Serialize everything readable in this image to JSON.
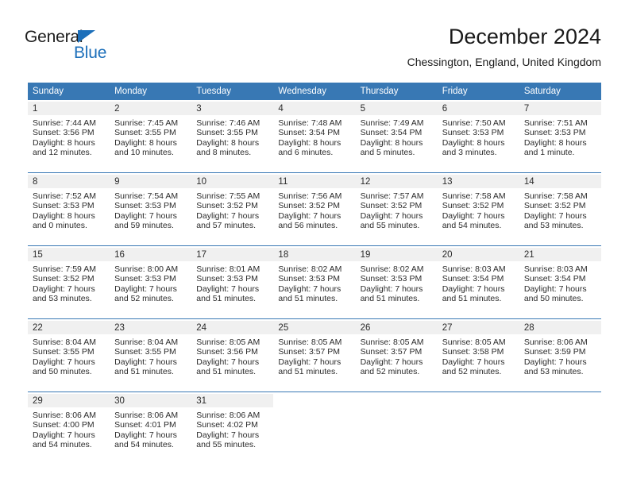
{
  "brand": {
    "name_top": "General",
    "name_bottom": "Blue",
    "accent_color": "#1c6fba"
  },
  "header": {
    "month_title": "December 2024",
    "location": "Chessington, England, United Kingdom"
  },
  "calendar": {
    "header_bg": "#3878b4",
    "daynum_bg": "#f0f0f0",
    "weekday_headers": [
      "Sunday",
      "Monday",
      "Tuesday",
      "Wednesday",
      "Thursday",
      "Friday",
      "Saturday"
    ],
    "weeks": [
      [
        {
          "day": "1",
          "sunrise": "Sunrise: 7:44 AM",
          "sunset": "Sunset: 3:56 PM",
          "daylight1": "Daylight: 8 hours",
          "daylight2": "and 12 minutes."
        },
        {
          "day": "2",
          "sunrise": "Sunrise: 7:45 AM",
          "sunset": "Sunset: 3:55 PM",
          "daylight1": "Daylight: 8 hours",
          "daylight2": "and 10 minutes."
        },
        {
          "day": "3",
          "sunrise": "Sunrise: 7:46 AM",
          "sunset": "Sunset: 3:55 PM",
          "daylight1": "Daylight: 8 hours",
          "daylight2": "and 8 minutes."
        },
        {
          "day": "4",
          "sunrise": "Sunrise: 7:48 AM",
          "sunset": "Sunset: 3:54 PM",
          "daylight1": "Daylight: 8 hours",
          "daylight2": "and 6 minutes."
        },
        {
          "day": "5",
          "sunrise": "Sunrise: 7:49 AM",
          "sunset": "Sunset: 3:54 PM",
          "daylight1": "Daylight: 8 hours",
          "daylight2": "and 5 minutes."
        },
        {
          "day": "6",
          "sunrise": "Sunrise: 7:50 AM",
          "sunset": "Sunset: 3:53 PM",
          "daylight1": "Daylight: 8 hours",
          "daylight2": "and 3 minutes."
        },
        {
          "day": "7",
          "sunrise": "Sunrise: 7:51 AM",
          "sunset": "Sunset: 3:53 PM",
          "daylight1": "Daylight: 8 hours",
          "daylight2": "and 1 minute."
        }
      ],
      [
        {
          "day": "8",
          "sunrise": "Sunrise: 7:52 AM",
          "sunset": "Sunset: 3:53 PM",
          "daylight1": "Daylight: 8 hours",
          "daylight2": "and 0 minutes."
        },
        {
          "day": "9",
          "sunrise": "Sunrise: 7:54 AM",
          "sunset": "Sunset: 3:53 PM",
          "daylight1": "Daylight: 7 hours",
          "daylight2": "and 59 minutes."
        },
        {
          "day": "10",
          "sunrise": "Sunrise: 7:55 AM",
          "sunset": "Sunset: 3:52 PM",
          "daylight1": "Daylight: 7 hours",
          "daylight2": "and 57 minutes."
        },
        {
          "day": "11",
          "sunrise": "Sunrise: 7:56 AM",
          "sunset": "Sunset: 3:52 PM",
          "daylight1": "Daylight: 7 hours",
          "daylight2": "and 56 minutes."
        },
        {
          "day": "12",
          "sunrise": "Sunrise: 7:57 AM",
          "sunset": "Sunset: 3:52 PM",
          "daylight1": "Daylight: 7 hours",
          "daylight2": "and 55 minutes."
        },
        {
          "day": "13",
          "sunrise": "Sunrise: 7:58 AM",
          "sunset": "Sunset: 3:52 PM",
          "daylight1": "Daylight: 7 hours",
          "daylight2": "and 54 minutes."
        },
        {
          "day": "14",
          "sunrise": "Sunrise: 7:58 AM",
          "sunset": "Sunset: 3:52 PM",
          "daylight1": "Daylight: 7 hours",
          "daylight2": "and 53 minutes."
        }
      ],
      [
        {
          "day": "15",
          "sunrise": "Sunrise: 7:59 AM",
          "sunset": "Sunset: 3:52 PM",
          "daylight1": "Daylight: 7 hours",
          "daylight2": "and 53 minutes."
        },
        {
          "day": "16",
          "sunrise": "Sunrise: 8:00 AM",
          "sunset": "Sunset: 3:53 PM",
          "daylight1": "Daylight: 7 hours",
          "daylight2": "and 52 minutes."
        },
        {
          "day": "17",
          "sunrise": "Sunrise: 8:01 AM",
          "sunset": "Sunset: 3:53 PM",
          "daylight1": "Daylight: 7 hours",
          "daylight2": "and 51 minutes."
        },
        {
          "day": "18",
          "sunrise": "Sunrise: 8:02 AM",
          "sunset": "Sunset: 3:53 PM",
          "daylight1": "Daylight: 7 hours",
          "daylight2": "and 51 minutes."
        },
        {
          "day": "19",
          "sunrise": "Sunrise: 8:02 AM",
          "sunset": "Sunset: 3:53 PM",
          "daylight1": "Daylight: 7 hours",
          "daylight2": "and 51 minutes."
        },
        {
          "day": "20",
          "sunrise": "Sunrise: 8:03 AM",
          "sunset": "Sunset: 3:54 PM",
          "daylight1": "Daylight: 7 hours",
          "daylight2": "and 51 minutes."
        },
        {
          "day": "21",
          "sunrise": "Sunrise: 8:03 AM",
          "sunset": "Sunset: 3:54 PM",
          "daylight1": "Daylight: 7 hours",
          "daylight2": "and 50 minutes."
        }
      ],
      [
        {
          "day": "22",
          "sunrise": "Sunrise: 8:04 AM",
          "sunset": "Sunset: 3:55 PM",
          "daylight1": "Daylight: 7 hours",
          "daylight2": "and 50 minutes."
        },
        {
          "day": "23",
          "sunrise": "Sunrise: 8:04 AM",
          "sunset": "Sunset: 3:55 PM",
          "daylight1": "Daylight: 7 hours",
          "daylight2": "and 51 minutes."
        },
        {
          "day": "24",
          "sunrise": "Sunrise: 8:05 AM",
          "sunset": "Sunset: 3:56 PM",
          "daylight1": "Daylight: 7 hours",
          "daylight2": "and 51 minutes."
        },
        {
          "day": "25",
          "sunrise": "Sunrise: 8:05 AM",
          "sunset": "Sunset: 3:57 PM",
          "daylight1": "Daylight: 7 hours",
          "daylight2": "and 51 minutes."
        },
        {
          "day": "26",
          "sunrise": "Sunrise: 8:05 AM",
          "sunset": "Sunset: 3:57 PM",
          "daylight1": "Daylight: 7 hours",
          "daylight2": "and 52 minutes."
        },
        {
          "day": "27",
          "sunrise": "Sunrise: 8:05 AM",
          "sunset": "Sunset: 3:58 PM",
          "daylight1": "Daylight: 7 hours",
          "daylight2": "and 52 minutes."
        },
        {
          "day": "28",
          "sunrise": "Sunrise: 8:06 AM",
          "sunset": "Sunset: 3:59 PM",
          "daylight1": "Daylight: 7 hours",
          "daylight2": "and 53 minutes."
        }
      ],
      [
        {
          "day": "29",
          "sunrise": "Sunrise: 8:06 AM",
          "sunset": "Sunset: 4:00 PM",
          "daylight1": "Daylight: 7 hours",
          "daylight2": "and 54 minutes."
        },
        {
          "day": "30",
          "sunrise": "Sunrise: 8:06 AM",
          "sunset": "Sunset: 4:01 PM",
          "daylight1": "Daylight: 7 hours",
          "daylight2": "and 54 minutes."
        },
        {
          "day": "31",
          "sunrise": "Sunrise: 8:06 AM",
          "sunset": "Sunset: 4:02 PM",
          "daylight1": "Daylight: 7 hours",
          "daylight2": "and 55 minutes."
        },
        {
          "day": "",
          "sunrise": "",
          "sunset": "",
          "daylight1": "",
          "daylight2": ""
        },
        {
          "day": "",
          "sunrise": "",
          "sunset": "",
          "daylight1": "",
          "daylight2": ""
        },
        {
          "day": "",
          "sunrise": "",
          "sunset": "",
          "daylight1": "",
          "daylight2": ""
        },
        {
          "day": "",
          "sunrise": "",
          "sunset": "",
          "daylight1": "",
          "daylight2": ""
        }
      ]
    ]
  }
}
